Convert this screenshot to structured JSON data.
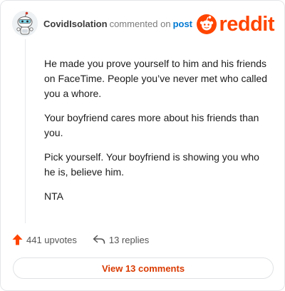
{
  "header": {
    "username": "CovidIsolation",
    "verb": "commented on",
    "post_link": "post",
    "brand": "reddit"
  },
  "comment": {
    "paragraphs": [
      "He made you prove yourself to him and his friends on FaceTime. People you’ve never met who called you a whore.",
      "Your boyfriend cares more about his friends than you.",
      "Pick yourself. Your boyfriend is showing you who he is, believe him.",
      "NTA"
    ]
  },
  "actions": {
    "upvotes": "441 upvotes",
    "replies": "13 replies"
  },
  "view_button": "View 13 comments",
  "colors": {
    "brand": "#ff4500",
    "link": "#0079d3",
    "button_text": "#d93a00"
  },
  "icons": {
    "upvote": "arrow-up-icon",
    "reply": "reply-arrow-icon",
    "logo": "reddit-snoo-icon"
  }
}
